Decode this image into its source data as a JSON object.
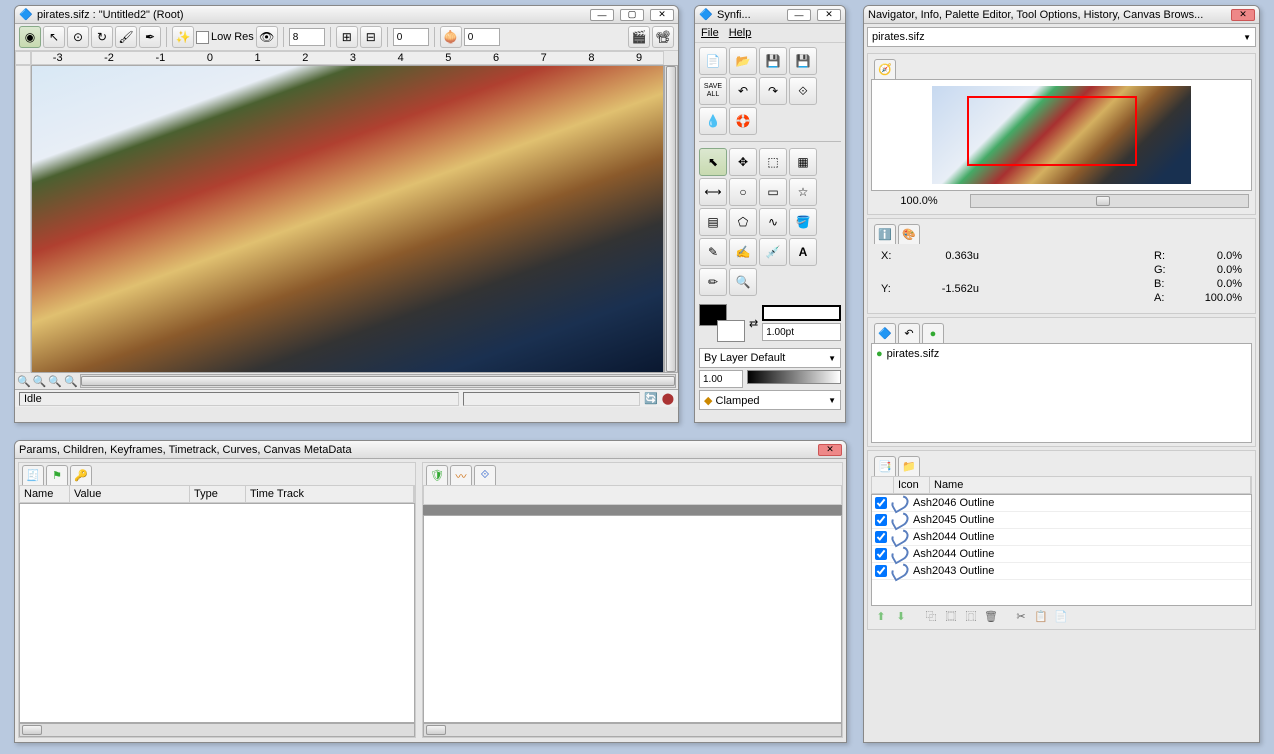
{
  "canvasWindow": {
    "title": "pirates.sifz : \"Untitled2\" (Root)",
    "lowResLabel": "Low Res",
    "spin1": "8",
    "spin2": "0",
    "spin3": "0",
    "rulerMarks": [
      "-3",
      "-2",
      "-1",
      "0",
      "1",
      "2",
      "3",
      "4",
      "5",
      "6",
      "7",
      "8",
      "9"
    ],
    "status": "Idle"
  },
  "toolbox": {
    "title": "Synfi...",
    "menu": {
      "file": "File",
      "help": "Help"
    },
    "saveAll": "SAVE ALL",
    "strokeWidth": "1.00pt",
    "blendMode": "By Layer Default",
    "opacity": "1.00",
    "clamped": "Clamped"
  },
  "rightPanel": {
    "title": "Navigator, Info, Palette Editor, Tool Options, History, Canvas Brows...",
    "fileCombo": "pirates.sifz",
    "zoom": "100.0%",
    "info": {
      "xLabel": "X:",
      "xVal": "0.363u",
      "yLabel": "Y:",
      "yVal": "-1.562u",
      "rLabel": "R:",
      "rVal": "0.0%",
      "gLabel": "G:",
      "gVal": "0.0%",
      "bLabel": "B:",
      "bVal": "0.0%",
      "aLabel": "A:",
      "aVal": "100.0%"
    },
    "canvasItem": "pirates.sifz",
    "layerHeader": {
      "icon": "Icon",
      "name": "Name"
    },
    "layers": [
      "Ash2046 Outline",
      "Ash2045 Outline",
      "Ash2044 Outline",
      "Ash2044 Outline",
      "Ash2043 Outline"
    ]
  },
  "paramsPanel": {
    "title": "Params, Children, Keyframes, Timetrack, Curves, Canvas MetaData",
    "cols": {
      "name": "Name",
      "value": "Value",
      "type": "Type",
      "track": "Time Track"
    }
  }
}
